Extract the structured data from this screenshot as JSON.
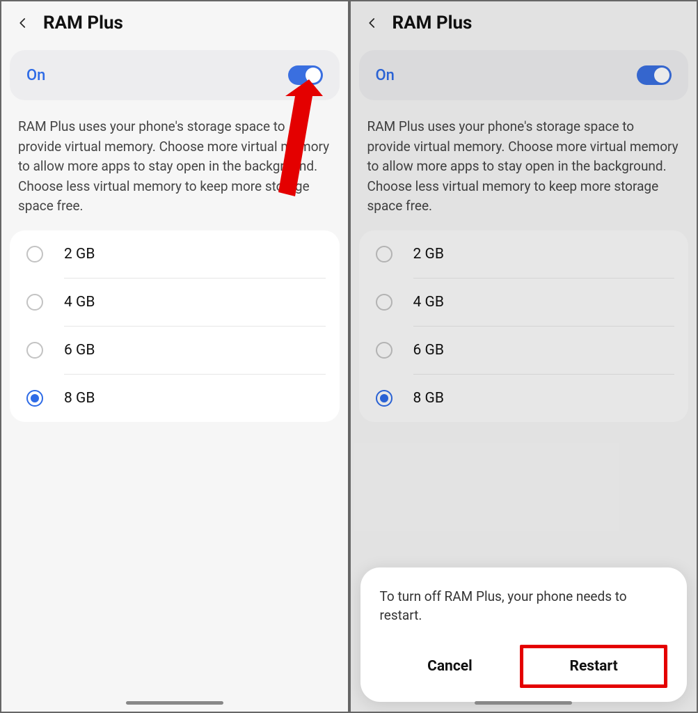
{
  "left": {
    "title": "RAM Plus",
    "toggle_label": "On",
    "description": "RAM Plus uses your phone's storage space to provide virtual memory. Choose more virtual memory to allow more apps to stay open in the background. Choose less virtual memory to keep more storage space free.",
    "options": [
      {
        "label": "2 GB",
        "selected": false
      },
      {
        "label": "4 GB",
        "selected": false
      },
      {
        "label": "6 GB",
        "selected": false
      },
      {
        "label": "8 GB",
        "selected": true
      }
    ]
  },
  "right": {
    "title": "RAM Plus",
    "toggle_label": "On",
    "description": "RAM Plus uses your phone's storage space to provide virtual memory. Choose more virtual memory to allow more apps to stay open in the background. Choose less virtual memory to keep more storage space free.",
    "options": [
      {
        "label": "2 GB",
        "selected": false
      },
      {
        "label": "4 GB",
        "selected": false
      },
      {
        "label": "6 GB",
        "selected": false
      },
      {
        "label": "8 GB",
        "selected": true
      }
    ],
    "sheet": {
      "message": "To turn off RAM Plus, your phone needs to restart.",
      "cancel": "Cancel",
      "restart": "Restart"
    }
  }
}
